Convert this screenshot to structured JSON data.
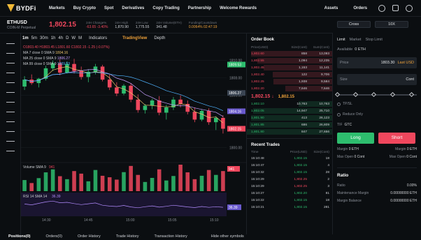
{
  "brand": {
    "name": "BYDFi"
  },
  "nav": {
    "items": [
      "Markets",
      "Buy Crypto",
      "Spot",
      "Derivatives",
      "Copy Trading",
      "Partnership",
      "Welcome Rewards"
    ],
    "right": [
      "Assets",
      "Orders"
    ]
  },
  "ticker": {
    "symbol": "ETHUSD",
    "sub": "COIN-M Perpetual",
    "last_price": "1,802.15",
    "stats": [
      {
        "label": "24H Change%",
        "value": "-63.65 -3.40%",
        "tone": "red"
      },
      {
        "label": "24H High",
        "value": "1,870.90",
        "tone": ""
      },
      {
        "label": "24H Low",
        "value": "1,775.55",
        "tone": ""
      },
      {
        "label": "24H Volume(ETH)",
        "value": "341.48",
        "tone": ""
      },
      {
        "label": "Funding/Countdown",
        "value": "0.0064% 02:47:19",
        "tone": "org"
      }
    ]
  },
  "chart_toolbar": {
    "timeframes": [
      "1m",
      "5m",
      "30m",
      "1h",
      "4h",
      "D",
      "W",
      "M"
    ],
    "active": "1m",
    "indicators": "Indicators",
    "tradingview": "TradingView",
    "depth": "Depth"
  },
  "legend": {
    "ohlc": "O1803.40 H1803.45 L1801.60 C1802.15 -1.25 (-0.07%)",
    "ma7": "MA 7 close 0 SMA 9",
    "ma7v": "1804.16",
    "ma25": "MA 25 close 0 SMA 9",
    "ma25v": "1806.27",
    "ma99": "MA 99 close 0 SMA 9",
    "ma99v": "1809.53",
    "vol": "Volume SMA 9",
    "volv": "941",
    "rsi": "RSI 14 SMA 14",
    "rsiv": "36.39"
  },
  "chart_data": {
    "type": "candlestick",
    "price_axis": [
      "1810.00",
      "1808.00",
      "1806.00",
      "1804.00",
      "1802.00",
      "1800.00"
    ],
    "price_tags": [
      "1809.53",
      "1806.27",
      "1804.16",
      "1802.15"
    ],
    "ylim": [
      1798.5,
      1811.5
    ],
    "time_axis": [
      "14:30",
      "14:45",
      "15:00",
      "15:05",
      "15:10"
    ],
    "candles": [
      [
        1807.0,
        1808.2,
        1806.6,
        1807.8
      ],
      [
        1807.8,
        1808.4,
        1807.2,
        1807.4
      ],
      [
        1807.4,
        1808.0,
        1806.9,
        1807.9
      ],
      [
        1807.9,
        1809.4,
        1807.7,
        1809.1
      ],
      [
        1809.1,
        1810.0,
        1808.8,
        1809.7
      ],
      [
        1809.7,
        1810.1,
        1808.3,
        1808.6
      ],
      [
        1808.6,
        1809.9,
        1808.5,
        1809.6
      ],
      [
        1809.6,
        1810.2,
        1808.5,
        1808.8
      ],
      [
        1808.8,
        1809.3,
        1807.8,
        1808.1
      ],
      [
        1808.1,
        1809.0,
        1807.5,
        1808.7
      ],
      [
        1808.7,
        1809.6,
        1808.4,
        1809.3
      ],
      [
        1809.3,
        1809.5,
        1807.6,
        1807.8
      ],
      [
        1807.8,
        1808.4,
        1806.6,
        1806.9
      ],
      [
        1806.9,
        1807.5,
        1805.9,
        1806.2
      ],
      [
        1806.2,
        1807.3,
        1806.0,
        1807.1
      ],
      [
        1807.1,
        1807.4,
        1805.2,
        1805.5
      ],
      [
        1805.5,
        1806.1,
        1804.0,
        1804.3
      ],
      [
        1804.3,
        1805.0,
        1803.9,
        1804.8
      ],
      [
        1804.8,
        1805.6,
        1804.4,
        1805.4
      ],
      [
        1805.4,
        1805.9,
        1803.7,
        1804.0
      ],
      [
        1804.0,
        1804.9,
        1803.2,
        1804.6
      ],
      [
        1804.6,
        1805.8,
        1804.3,
        1805.5
      ],
      [
        1805.5,
        1806.0,
        1804.6,
        1805.0
      ],
      [
        1805.0,
        1805.4,
        1803.8,
        1804.1
      ],
      [
        1804.1,
        1804.6,
        1802.9,
        1803.2
      ],
      [
        1803.2,
        1804.4,
        1803.0,
        1804.2
      ],
      [
        1804.2,
        1804.5,
        1802.6,
        1802.9
      ],
      [
        1802.9,
        1803.6,
        1802.0,
        1803.4
      ],
      [
        1803.4,
        1803.7,
        1801.6,
        1802.15
      ]
    ],
    "volumes": [
      520,
      380,
      610,
      880,
      1020,
      700,
      560,
      940,
      820,
      460,
      990,
      720,
      650,
      540,
      890,
      1180,
      760,
      430,
      620,
      1020,
      500,
      710,
      1240,
      880,
      560,
      720,
      990,
      760,
      941
    ],
    "rsi": [
      52,
      48,
      55,
      62,
      66,
      58,
      60,
      54,
      49,
      53,
      57,
      46,
      42,
      40,
      45,
      38,
      34,
      39,
      43,
      37,
      41,
      46,
      42,
      38,
      35,
      40,
      36,
      39,
      36.39
    ]
  },
  "orderbook": {
    "title": "Order Book",
    "headers": [
      "Price(USD)",
      "Size(Cont)",
      "Sum(Cont)"
    ],
    "asks": [
      [
        "1,802.60",
        "858",
        "13,093",
        0.95
      ],
      [
        "1,802.55",
        "1,094",
        "12,235",
        0.88
      ],
      [
        "1,802.45",
        "1,153",
        "11,141",
        0.8
      ],
      [
        "1,802.40",
        "122",
        "9,706",
        0.7
      ],
      [
        "1,802.25",
        "1,938",
        "9,584",
        0.69
      ],
      [
        "1,802.20",
        "7,646",
        "7,646",
        0.55
      ]
    ],
    "mid": "1,802.15",
    "mid_ref": "1,802.15",
    "bids": [
      [
        "1,802.10",
        "10,763",
        "10,763",
        0.39
      ],
      [
        "1,802.05",
        "14,947",
        "25,710",
        0.93
      ],
      [
        "1,801.90",
        "413",
        "26,123",
        0.95
      ],
      [
        "1,801.85",
        "686",
        "26,809",
        0.97
      ],
      [
        "1,801.80",
        "847",
        "27,656",
        1.0
      ]
    ]
  },
  "recent_trades": {
    "title": "Recent Trades",
    "headers": [
      "Time",
      "Price(USD)",
      "Size(Cont)"
    ],
    "rows": [
      [
        "15:10:48",
        "1,802.15",
        "18",
        "g"
      ],
      [
        "15:10:47",
        "1,802.15",
        "4",
        "g"
      ],
      [
        "15:10:32",
        "1,802.15",
        "28",
        "g"
      ],
      [
        "15:10:29",
        "1,802.25",
        "2",
        "r"
      ],
      [
        "15:10:29",
        "1,802.25",
        "3",
        "r"
      ],
      [
        "15:10:27",
        "1,802.20",
        "81",
        "g"
      ],
      [
        "15:10:22",
        "1,802.15",
        "18",
        "g"
      ],
      [
        "15:10:21",
        "1,802.15",
        "281",
        "g"
      ]
    ]
  },
  "trade": {
    "mode_left": "Cross",
    "mode_right": "10X",
    "order_types": [
      "Limit",
      "Market",
      "Stop Limit"
    ],
    "available_label": "Available",
    "available": "0 ETH",
    "price_label": "Price",
    "price_value": "1803.30",
    "price_suffix": "Last USD",
    "size_label": "Size",
    "size_unit": "Cont",
    "tpsl": "TP/SL",
    "reduce_only": "Reduce Only",
    "tif": "TIF",
    "tif_value": "GTC",
    "long": "Long",
    "short": "Short",
    "margin_left": "Margin",
    "margin_left_v": "0 ETH",
    "margin_right": "Margin",
    "margin_right_v": "0 ETH",
    "maxopen_left": "Max Open",
    "maxopen_left_v": "0 Cont",
    "maxopen_right": "Max Open",
    "maxopen_right_v": "0 Cont",
    "ratio_title": "Ratio",
    "ratio_label": "Ratio",
    "ratio_value": "0.00%",
    "mm_label": "Maintenance Margin",
    "mm_value": "0.00000000 ETH",
    "mb_label": "Margin Balance",
    "mb_value": "0.00000000 ETH"
  },
  "bottom_tabs": [
    "Positions(0)",
    "Orders(0)",
    "Order History",
    "Trade History",
    "Transaction History",
    "Hide other symbols"
  ],
  "colors": {
    "up": "#2ebd6e",
    "down": "#f0475d",
    "accent": "#f0a23a",
    "bg": "#0b0e11"
  }
}
